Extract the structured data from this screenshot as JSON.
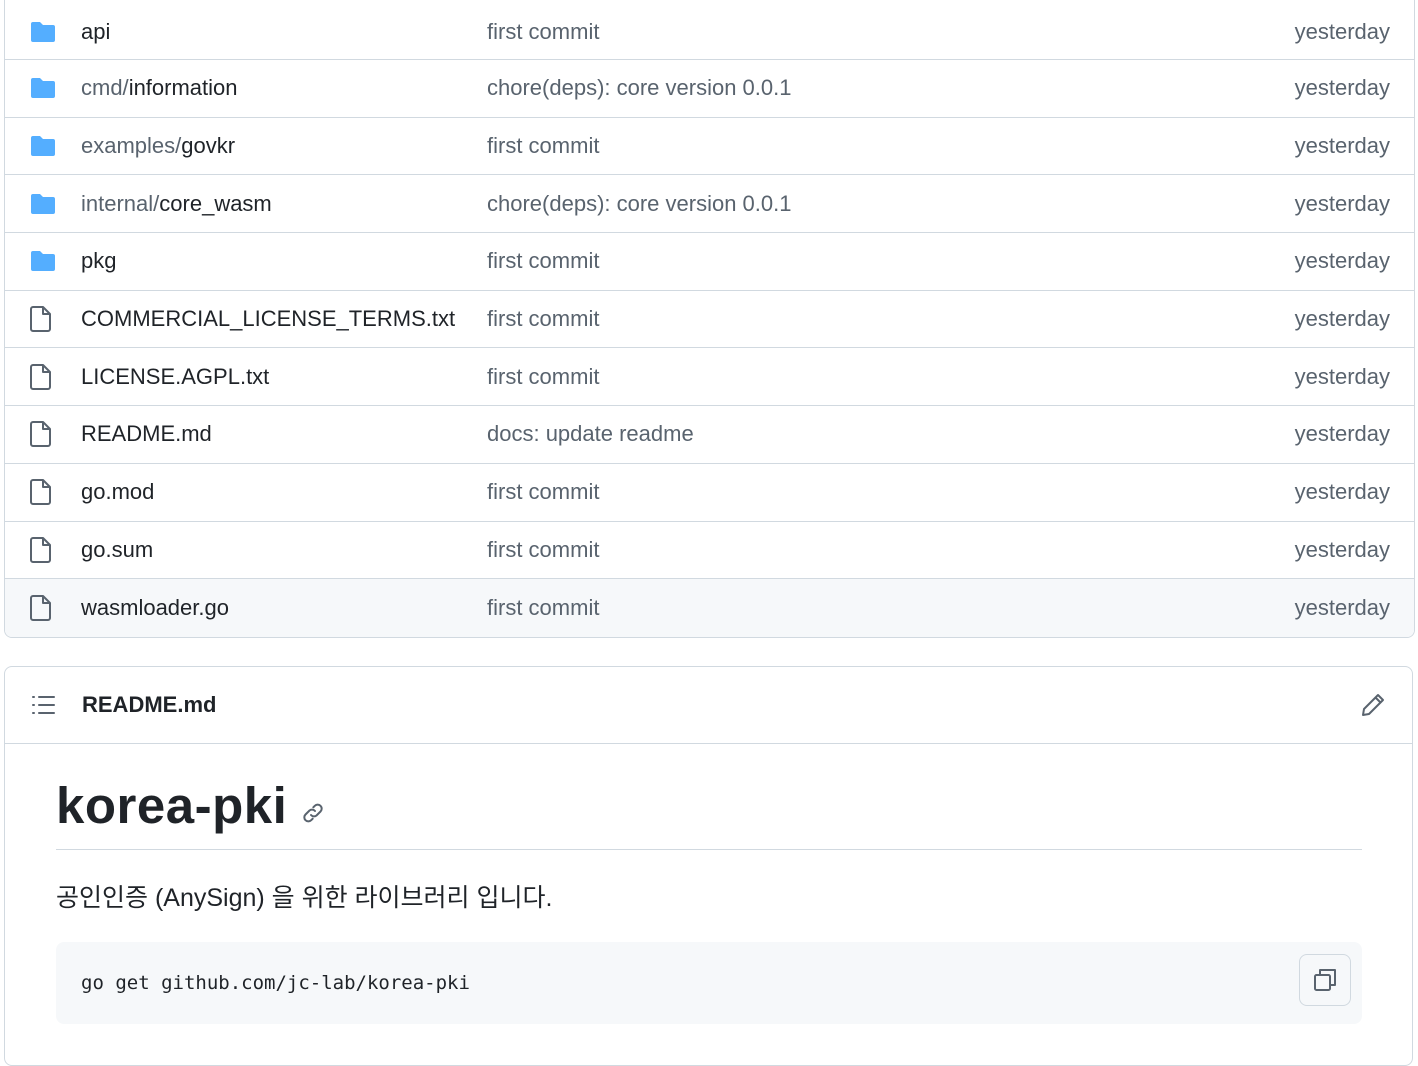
{
  "files": [
    {
      "type": "folder",
      "prefix": "",
      "name": "api",
      "message": "first commit",
      "date": "yesterday"
    },
    {
      "type": "folder",
      "prefix": "cmd/",
      "name": "information",
      "message": "chore(deps): core version 0.0.1",
      "date": "yesterday"
    },
    {
      "type": "folder",
      "prefix": "examples/",
      "name": "govkr",
      "message": "first commit",
      "date": "yesterday"
    },
    {
      "type": "folder",
      "prefix": "internal/",
      "name": "core_wasm",
      "message": "chore(deps): core version 0.0.1",
      "date": "yesterday"
    },
    {
      "type": "folder",
      "prefix": "",
      "name": "pkg",
      "message": "first commit",
      "date": "yesterday"
    },
    {
      "type": "file",
      "prefix": "",
      "name": "COMMERCIAL_LICENSE_TERMS.txt",
      "message": "first commit",
      "date": "yesterday"
    },
    {
      "type": "file",
      "prefix": "",
      "name": "LICENSE.AGPL.txt",
      "message": "first commit",
      "date": "yesterday"
    },
    {
      "type": "file",
      "prefix": "",
      "name": "README.md",
      "message": "docs: update readme",
      "date": "yesterday"
    },
    {
      "type": "file",
      "prefix": "",
      "name": "go.mod",
      "message": "first commit",
      "date": "yesterday"
    },
    {
      "type": "file",
      "prefix": "",
      "name": "go.sum",
      "message": "first commit",
      "date": "yesterday"
    },
    {
      "type": "file",
      "prefix": "",
      "name": "wasmloader.go",
      "message": "first commit",
      "date": "yesterday"
    }
  ],
  "readme": {
    "filename": "README.md",
    "heading": "korea-pki",
    "description": "공인인증 (AnySign) 을 위한 라이브러리 입니다.",
    "code": "go get github.com/jc-lab/korea-pki"
  },
  "colors": {
    "folder": "#54aeff",
    "file_icon": "#59636e",
    "border": "#d1d9e0",
    "muted_text": "#59636e"
  }
}
